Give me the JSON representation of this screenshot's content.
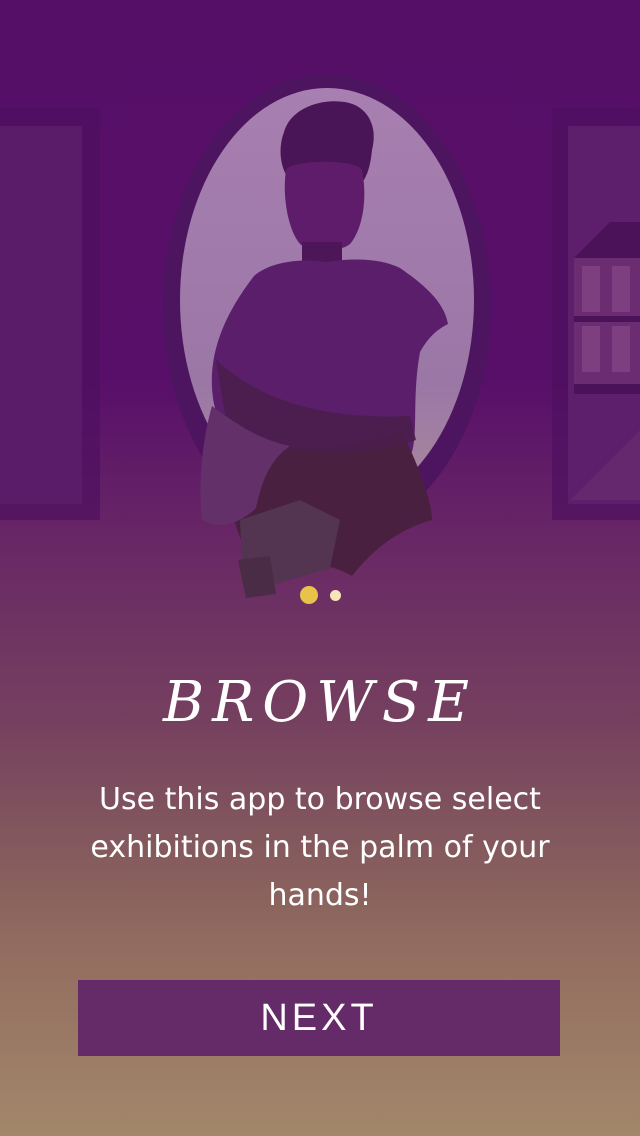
{
  "onboarding": {
    "title": "BROWSE",
    "description": "Use this app to browse select exhibitions in the palm of your hands!",
    "next_label": "NEXT",
    "page_indicator": {
      "total": 2,
      "active_index": 0
    }
  },
  "colors": {
    "accent_dot_active": "#e9c24a",
    "accent_dot_inactive": "#f3e6b9",
    "button_background": "#652a68",
    "background_top": "#560f67",
    "background_bottom": "#a2876a"
  },
  "illustration": {
    "subject": "portrait-frame-woman-silhouette"
  }
}
